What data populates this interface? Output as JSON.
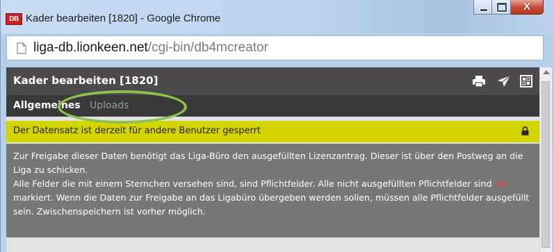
{
  "window": {
    "app_badge": "DB",
    "title": "Kader bearbeiten [1820] - Google Chrome",
    "controls": {
      "minimize_icon": "minimize-icon",
      "maximize_icon": "maximize-icon",
      "close_glyph": "X"
    }
  },
  "addressbar": {
    "icon": "page-icon",
    "host": "liga-db.lionkeen.net",
    "path": "/cgi-bin/db4mcreator"
  },
  "panel": {
    "title": "Kader bearbeiten [1820]",
    "icons": [
      "print-icon",
      "send-icon",
      "window-icon"
    ]
  },
  "tabs": [
    {
      "label": "Allgemeines",
      "active": true
    },
    {
      "label": "Uploads",
      "active": false
    }
  ],
  "notice": {
    "text": "Der Datensatz ist derzeit für andere Benutzer gesperrt",
    "icon": "lock-icon"
  },
  "info": {
    "line1": "Zur Freigabe dieser Daten benötigt das Liga-Büro den ausgefüllten Lizenzantrag. Dieser ist über den Postweg an die Liga zu schicken.",
    "line2_part1": "Alle Felder die mit einem Sternchen versehen sind, sind Pflichtfelder. Alle nicht ausgefüllten Pflichtfelder sind",
    "line2_red": "rot",
    "line2_part2": "markiert. Wenn die Daten zur Freigabe an das Ligabüro übergeben werden sollen, müssen alle Pflichtfelder ausgefüllt sein. Zwischenspeichern ist vorher möglich."
  },
  "colors": {
    "header_bg": "#4b4b4b",
    "tabs_bg": "#393939",
    "notice_bg": "#d3d400",
    "info_bg": "#777777",
    "required_red": "#ff3c3c",
    "highlight_ring": "#8dc24f"
  }
}
